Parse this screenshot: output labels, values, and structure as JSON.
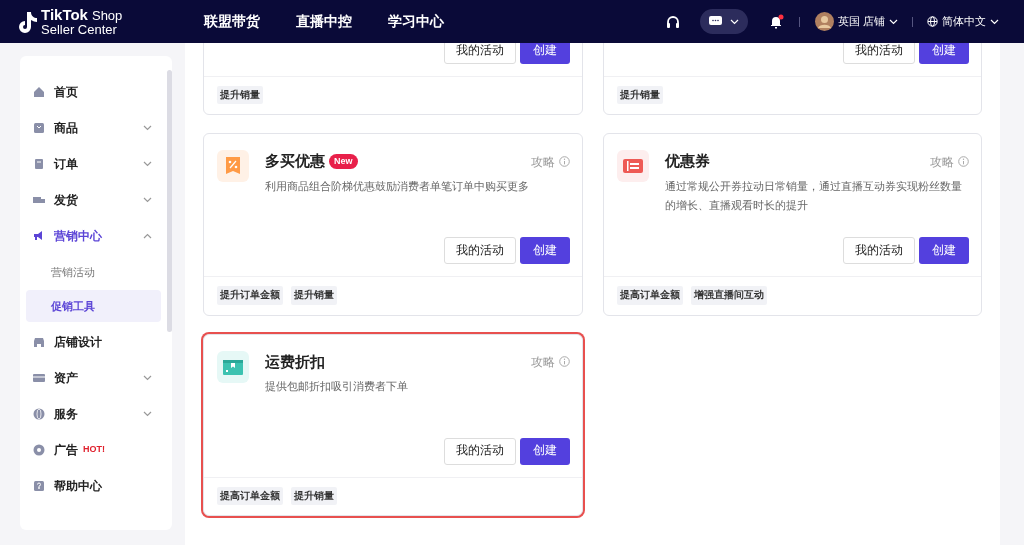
{
  "header": {
    "logo": {
      "brand": "TikTok",
      "product": "Shop",
      "subtitle": "Seller Center"
    },
    "nav": [
      "联盟带货",
      "直播中控",
      "学习中心"
    ],
    "notifications": {
      "unread": true
    },
    "account": {
      "name": "英国 店铺"
    },
    "language": "简体中文"
  },
  "sidebar": {
    "items": [
      {
        "label": "首页"
      },
      {
        "label": "商品",
        "expanded": false
      },
      {
        "label": "订单",
        "expanded": false
      },
      {
        "label": "发货",
        "expanded": false
      },
      {
        "label": "营销中心",
        "expanded": true,
        "children": [
          {
            "label": "营销活动",
            "selected": false
          },
          {
            "label": "促销工具",
            "selected": true
          }
        ]
      },
      {
        "label": "店铺设计"
      },
      {
        "label": "资产",
        "expanded": false
      },
      {
        "label": "服务",
        "expanded": false
      },
      {
        "label": "广告",
        "badge": "HOT!"
      },
      {
        "label": "帮助中心"
      }
    ]
  },
  "cards": [
    {
      "cut_off": true,
      "highlighted": false,
      "buttons": [
        "我的活动",
        "创建"
      ],
      "tags": [
        "提升销量"
      ]
    },
    {
      "cut_off": true,
      "highlighted": false,
      "buttons": [
        "我的活动",
        "创建"
      ],
      "tags": [
        "提升销量"
      ]
    },
    {
      "cut_off": false,
      "highlighted": false,
      "title": "多买优惠",
      "badge": "New",
      "guide": "攻略",
      "description": "利用商品组合阶梯优惠鼓励消费者单笔订单中购买更多",
      "buttons": [
        "我的活动",
        "创建"
      ],
      "tags": [
        "提升订单金额",
        "提升销量"
      ]
    },
    {
      "cut_off": false,
      "highlighted": false,
      "title": "优惠券",
      "guide": "攻略",
      "description": "通过常规公开券拉动日常销量，通过直播互动券实现粉丝数量的增长、直播观看时长的提升",
      "buttons": [
        "我的活动",
        "创建"
      ],
      "tags": [
        "提高订单金额",
        "增强直播间互动"
      ]
    },
    {
      "cut_off": false,
      "highlighted": true,
      "title": "运费折扣",
      "guide": "攻略",
      "description": "提供包邮折扣吸引消费者下单",
      "buttons": [
        "我的活动",
        "创建"
      ],
      "tags": [
        "提高订单金额",
        "提升销量"
      ]
    }
  ]
}
